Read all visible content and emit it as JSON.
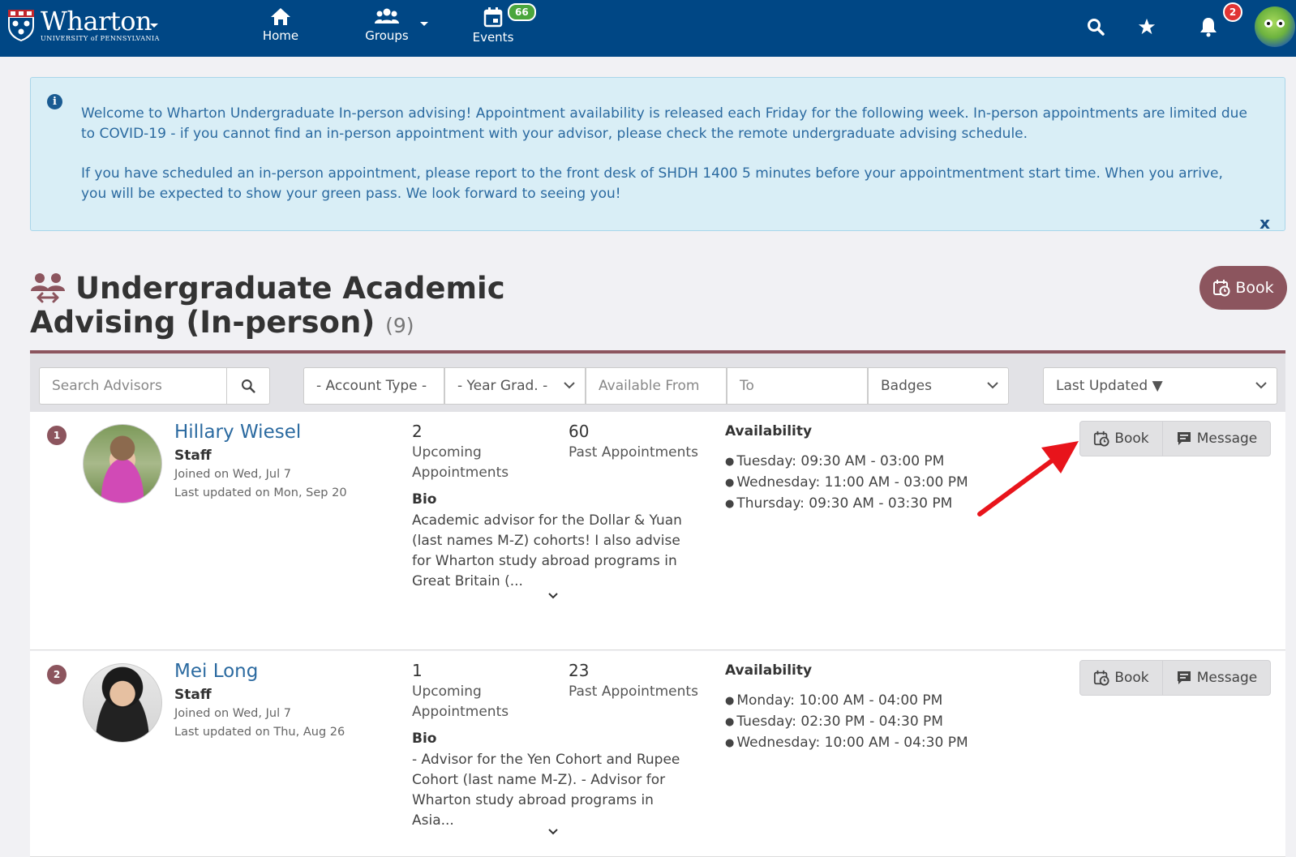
{
  "nav": {
    "logo_name": "Wharton",
    "logo_sub": "UNIVERSITY of PENNSYLVANIA",
    "items": [
      {
        "label": "Home",
        "icon": "home-icon"
      },
      {
        "label": "Groups",
        "icon": "groups-icon"
      },
      {
        "label": "Events",
        "icon": "calendar-icon",
        "badge": "66"
      }
    ],
    "notifications_badge": "2",
    "colors": {
      "bar": "#004785",
      "events_badge": "#4aa63c",
      "notif_badge": "#e03434"
    }
  },
  "alert": {
    "p1": "Welcome to Wharton Undergraduate In-person advising! Appointment availability is released each Friday for the following week. In-person appointments are limited due to COVID-19 - if you cannot find an in-person appointment with your advisor, please check the remote undergraduate advising schedule.",
    "p2": "If you have scheduled an in-person appointment, please report to the front desk of SHDH 1400 5 minutes before your appointmentment start time. When you arrive, you will be expected to show your green pass. We look forward to seeing you!",
    "close": "x"
  },
  "page": {
    "title": "Undergraduate Academic Advising (In-person)",
    "count": "(9)",
    "book_label": "Book",
    "accent": "#8c555e"
  },
  "filters": {
    "search_placeholder": "Search Advisors",
    "account_type": "- Account Type -",
    "year_grad": "- Year Grad. -",
    "available_from": "Available From",
    "to": "To",
    "badges": "Badges",
    "sort": "Last Updated ▼"
  },
  "advisors": [
    {
      "rank": "1",
      "name": "Hillary Wiesel",
      "role": "Staff",
      "joined": "Joined on Wed, Jul 7",
      "updated": "Last updated on Mon, Sep 20",
      "upcoming_count": "2",
      "upcoming_label": "Upcoming Appointments",
      "past_count": "60",
      "past_label": "Past Appointments",
      "bio_heading": "Bio",
      "bio": "Academic advisor for the Dollar & Yuan (last names M-Z) cohorts! I also advise for Wharton study abroad programs in Great Britain (...",
      "availability_heading": "Availability",
      "availability": [
        "Tuesday: 09:30 AM - 03:00 PM",
        "Wednesday: 11:00 AM - 03:00 PM",
        "Thursday: 09:30 AM - 03:30 PM"
      ],
      "book_label": "Book",
      "message_label": "Message"
    },
    {
      "rank": "2",
      "name": "Mei Long",
      "role": "Staff",
      "joined": "Joined on Wed, Jul 7",
      "updated": "Last updated on Thu, Aug 26",
      "upcoming_count": "1",
      "upcoming_label": "Upcoming Appointments",
      "past_count": "23",
      "past_label": "Past Appointments",
      "bio_heading": "Bio",
      "bio": "- Advisor for the Yen Cohort and Rupee Cohort (last name M-Z). - Advisor for Wharton study abroad programs in Asia...",
      "availability_heading": "Availability",
      "availability": [
        "Monday: 10:00 AM - 04:00 PM",
        "Tuesday: 02:30 PM - 04:30 PM",
        "Wednesday: 10:00 AM - 04:30 PM"
      ],
      "book_label": "Book",
      "message_label": "Message"
    }
  ]
}
